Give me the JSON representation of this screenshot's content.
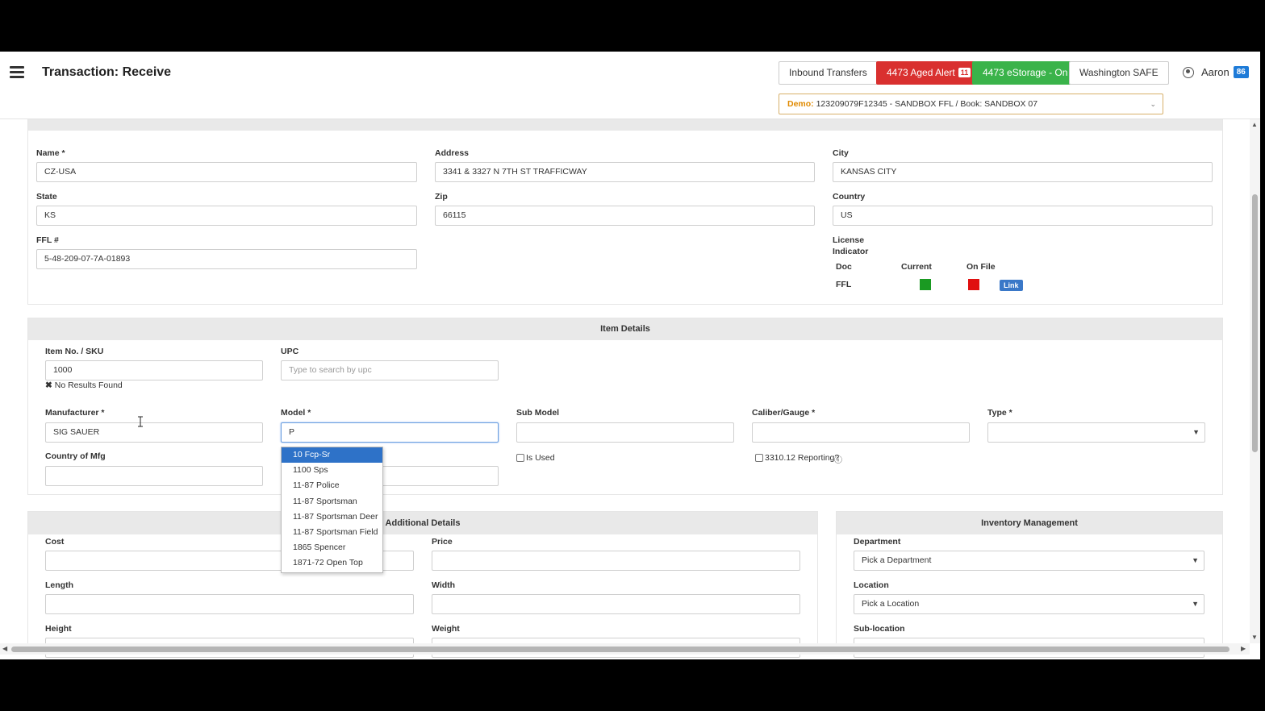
{
  "header": {
    "title": "Transaction: Receive",
    "buttons": {
      "inbound": "Inbound Transfers",
      "aged_alert": "4473 Aged Alert",
      "aged_alert_count": "11",
      "estorage": "4473 eStorage - On",
      "washington": "Washington SAFE"
    },
    "user_name": "Aaron",
    "user_badge": "86",
    "book_label": "Demo:",
    "book_value": "123209079F12345 - SANDBOX FFL / Book: SANDBOX 07"
  },
  "acquire_from": {
    "name_label": "Name *",
    "name_value": "CZ-USA",
    "address_label": "Address",
    "address_value": "3341 & 3327 N 7TH ST TRAFFICWAY",
    "city_label": "City",
    "city_value": "KANSAS CITY",
    "state_label": "State",
    "state_value": "KS",
    "zip_label": "Zip",
    "zip_value": "66115",
    "country_label": "Country",
    "country_value": "US",
    "ffl_label": "FFL #",
    "ffl_value": "5-48-209-07-7A-01893",
    "license_label_1": "License",
    "license_label_2": "Indicator",
    "col_doc": "Doc",
    "col_current": "Current",
    "col_onfile": "On File",
    "row_doc": "FFL",
    "current_color": "#1a9a22",
    "onfile_color": "#e01010",
    "link_label": "Link"
  },
  "item_details": {
    "title": "Item Details",
    "sku_label": "Item No. / SKU",
    "sku_value": "1000",
    "no_results": "No Results Found",
    "upc_label": "UPC",
    "upc_placeholder": "Type to search by upc",
    "manufacturer_label": "Manufacturer *",
    "manufacturer_value": "SIG SAUER",
    "model_label": "Model *",
    "model_value": "P",
    "submodel_label": "Sub Model",
    "caliber_label": "Caliber/Gauge *",
    "type_label": "Type *",
    "country_mfg_label": "Country of Mfg",
    "is_used_label": "Is Used",
    "reporting_label": "3310.12 Reporting?"
  },
  "model_suggestions": [
    "10 Fcp-Sr",
    "1100 Sps",
    "11-87 Police",
    "11-87 Sportsman",
    "11-87 Sportsman Deer",
    "11-87 Sportsman Field",
    "1865 Spencer",
    "1871-72 Open Top"
  ],
  "additional_details": {
    "title": "Additional Details",
    "cost_label": "Cost",
    "price_label": "Price",
    "length_label": "Length",
    "width_label": "Width",
    "height_label": "Height",
    "weight_label": "Weight"
  },
  "inventory": {
    "title": "Inventory Management",
    "department_label": "Department",
    "department_value": "Pick a Department",
    "location_label": "Location",
    "location_value": "Pick a Location",
    "sublocation_label": "Sub-location"
  }
}
